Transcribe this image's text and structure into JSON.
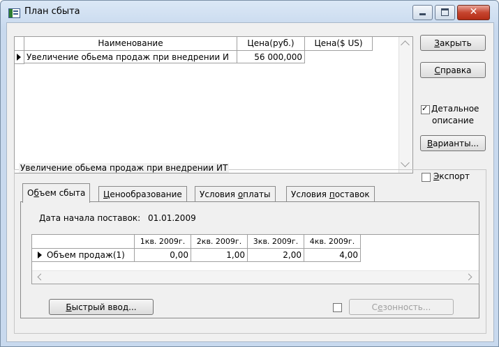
{
  "window": {
    "title": "План сбыта"
  },
  "top_grid": {
    "headers": [
      "Наименование",
      "Цена(руб.)",
      "Цена($ US)"
    ],
    "rows": [
      {
        "name": "Увеличение обьема продаж при внедрении И",
        "price_rub": "56 000,000",
        "price_usd": ""
      }
    ]
  },
  "buttons": {
    "close": {
      "pre": "",
      "u": "З",
      "post": "акрыть"
    },
    "help": {
      "pre": "",
      "u": "С",
      "post": "правка"
    },
    "variants": {
      "pre": "",
      "u": "В",
      "post": "арианты..."
    },
    "quick_input": {
      "pre": "",
      "u": "Б",
      "post": "ыстрый ввод..."
    },
    "seasonality": {
      "pre": "С",
      "u": "е",
      "post": "зонность..."
    }
  },
  "detail_checkbox": {
    "line1_u": "Д",
    "line1_post": "етальное",
    "line2": "описание",
    "checked": true
  },
  "group": {
    "label": "Увеличение обьема продаж при внедрении ИТ"
  },
  "export_checkbox": {
    "u": "Э",
    "post": "кспорт",
    "checked": false
  },
  "tabs": [
    {
      "pre": "О",
      "u": "б",
      "post": "ъем сбыта",
      "active": true
    },
    {
      "pre": "",
      "u": "Ц",
      "post": "енообразование",
      "active": false
    },
    {
      "pre": "Условия ",
      "u": "о",
      "post": "платы",
      "active": false
    },
    {
      "pre": "Условия ",
      "u": "п",
      "post": "оставок",
      "active": false
    }
  ],
  "start_date": {
    "label": "Дата начала поставок:",
    "value": "01.01.2009"
  },
  "volume_grid": {
    "headers": [
      "1кв. 2009г.",
      "2кв. 2009г.",
      "3кв. 2009г.",
      "4кв. 2009г."
    ],
    "row_label": "Объем продаж(1)",
    "values": [
      "0,00",
      "1,00",
      "2,00",
      "4,00"
    ]
  }
}
